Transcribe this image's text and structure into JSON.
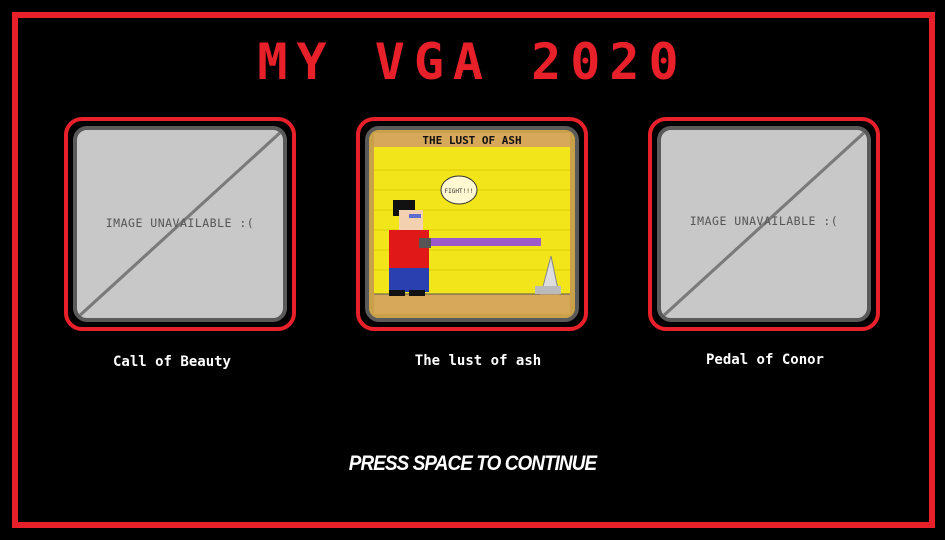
{
  "title": "MY VGA 2020",
  "games": [
    {
      "label": "Call of Beauty",
      "image_text": "IMAGE UNAVAILABLE :(",
      "has_image": false
    },
    {
      "label": "The lust of ash",
      "image_text": "THE LUST OF ASH",
      "bubble_text": "FIGHT!!!",
      "has_image": true
    },
    {
      "label": "Pedal of Conor",
      "image_text": "IMAGE UNAVAILABLE :(",
      "has_image": false
    }
  ],
  "prompt": "PRESS SPACE TO CONTINUE",
  "colors": {
    "accent": "#e8202a",
    "background": "#000000",
    "placeholder": "#c8c8c8"
  }
}
